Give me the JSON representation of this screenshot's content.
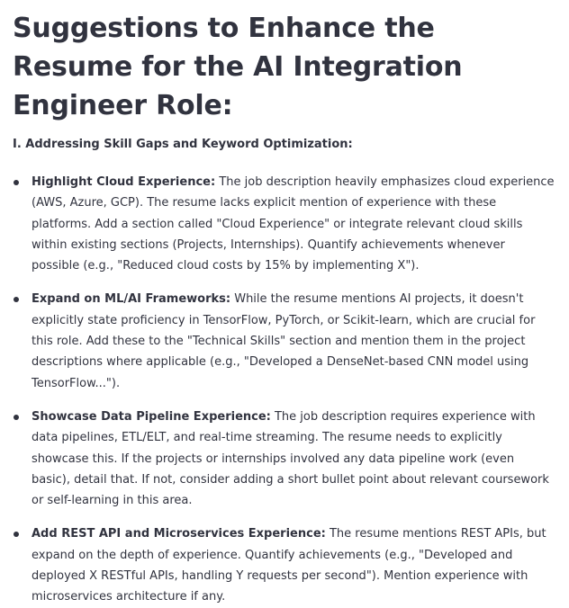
{
  "document": {
    "title": "Suggestions to Enhance the Resume for the AI Integration Engineer Role:",
    "section_heading": "I. Addressing Skill Gaps and Keyword Optimization:",
    "suggestions": [
      {
        "lead": "Highlight Cloud Experience:",
        "text": " The job description heavily emphasizes cloud experience (AWS, Azure, GCP). The resume lacks explicit mention of experience with these platforms. Add a section called \"Cloud Experience\" or integrate relevant cloud skills within existing sections (Projects, Internships). Quantify achievements whenever possible (e.g., \"Reduced cloud costs by 15% by implementing X\")."
      },
      {
        "lead": "Expand on ML/AI Frameworks:",
        "text": " While the resume mentions AI projects, it doesn't explicitly state proficiency in TensorFlow, PyTorch, or Scikit-learn, which are crucial for this role. Add these to the \"Technical Skills\" section and mention them in the project descriptions where applicable (e.g., \"Developed a DenseNet-based CNN model using TensorFlow...\")."
      },
      {
        "lead": "Showcase Data Pipeline Experience:",
        "text": " The job description requires experience with data pipelines, ETL/ELT, and real-time streaming. The resume needs to explicitly showcase this. If the projects or internships involved any data pipeline work (even basic), detail that. If not, consider adding a short bullet point about relevant coursework or self-learning in this area."
      },
      {
        "lead": "Add REST API and Microservices Experience:",
        "text": " The resume mentions REST APIs, but expand on the depth of experience. Quantify achievements (e.g., \"Developed and deployed X RESTful APIs, handling Y requests per second\"). Mention experience with microservices architecture if any."
      }
    ]
  }
}
